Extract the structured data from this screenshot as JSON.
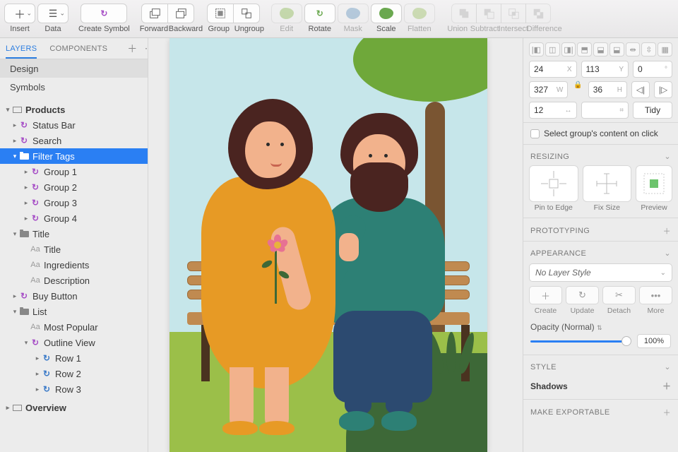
{
  "toolbar": {
    "insert": "Insert",
    "data": "Data",
    "create_symbol": "Create Symbol",
    "forward": "Forward",
    "backward": "Backward",
    "group": "Group",
    "ungroup": "Ungroup",
    "edit": "Edit",
    "rotate": "Rotate",
    "mask": "Mask",
    "scale": "Scale",
    "flatten": "Flatten",
    "union": "Union",
    "subtract": "Subtract",
    "intersect": "Intersect",
    "difference": "Difference"
  },
  "left": {
    "tabs": {
      "layers": "LAYERS",
      "components": "COMPONENTS"
    },
    "top": {
      "design": "Design",
      "symbols": "Symbols"
    },
    "artboard": "Products",
    "layers": {
      "status_bar": "Status Bar",
      "search": "Search",
      "filter_tags": "Filter Tags",
      "group1": "Group 1",
      "group2": "Group 2",
      "group3": "Group 3",
      "group4": "Group 4",
      "title": "Title",
      "title_text": "Title",
      "ingredients": "Ingredients",
      "description": "Description",
      "buy_button": "Buy Button",
      "list": "List",
      "most_popular": "Most Popular",
      "outline_view": "Outline View",
      "row1": "Row 1",
      "row2": "Row 2",
      "row3": "Row 3",
      "overview": "Overview"
    }
  },
  "inspector": {
    "x": "24",
    "xl": "X",
    "y": "113",
    "yl": "Y",
    "deg": "0",
    "degl": "°",
    "w": "327",
    "wl": "W",
    "h": "36",
    "hl": "H",
    "r": "12",
    "tidy": "Tidy",
    "select_group": "Select group's content on click",
    "resizing": "RESIZING",
    "pin": "Pin to Edge",
    "fix": "Fix Size",
    "preview": "Preview",
    "prototyping": "PROTOTYPING",
    "appearance": "APPEARANCE",
    "no_style": "No Layer Style",
    "create": "Create",
    "update": "Update",
    "detach": "Detach",
    "more": "More",
    "opacity_label": "Opacity (Normal)",
    "opacity_value": "100%",
    "style": "STYLE",
    "shadows": "Shadows",
    "exportable": "MAKE EXPORTABLE"
  }
}
